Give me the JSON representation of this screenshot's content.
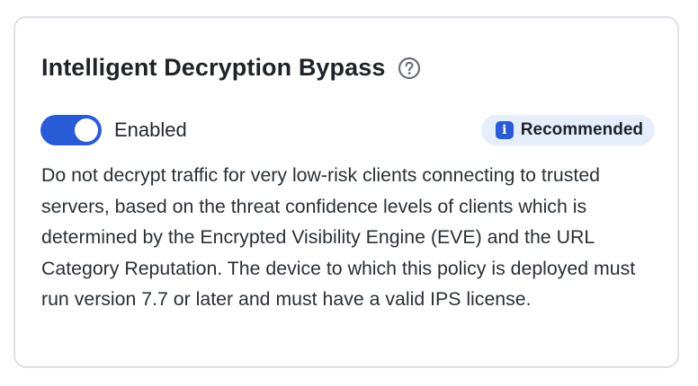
{
  "card": {
    "title": "Intelligent Decryption Bypass",
    "help_icon": "question-circle-icon",
    "toggle": {
      "state": true,
      "label": "Enabled"
    },
    "badge": {
      "icon": "info-icon",
      "icon_glyph": "i",
      "label": "Recommended"
    },
    "description": "Do not decrypt traffic for very low-risk clients connecting to trusted servers, based on the threat confidence levels of clients which is determined by the Encrypted Visibility Engine (EVE) and the URL Category Reputation. The device to which this policy is deployed must run version 7.7 or later and must have a valid IPS license."
  },
  "colors": {
    "accent": "#2a5bd7",
    "badge_bg": "#e6eefb",
    "border": "#dfe1e6",
    "text": "#1f2328"
  }
}
